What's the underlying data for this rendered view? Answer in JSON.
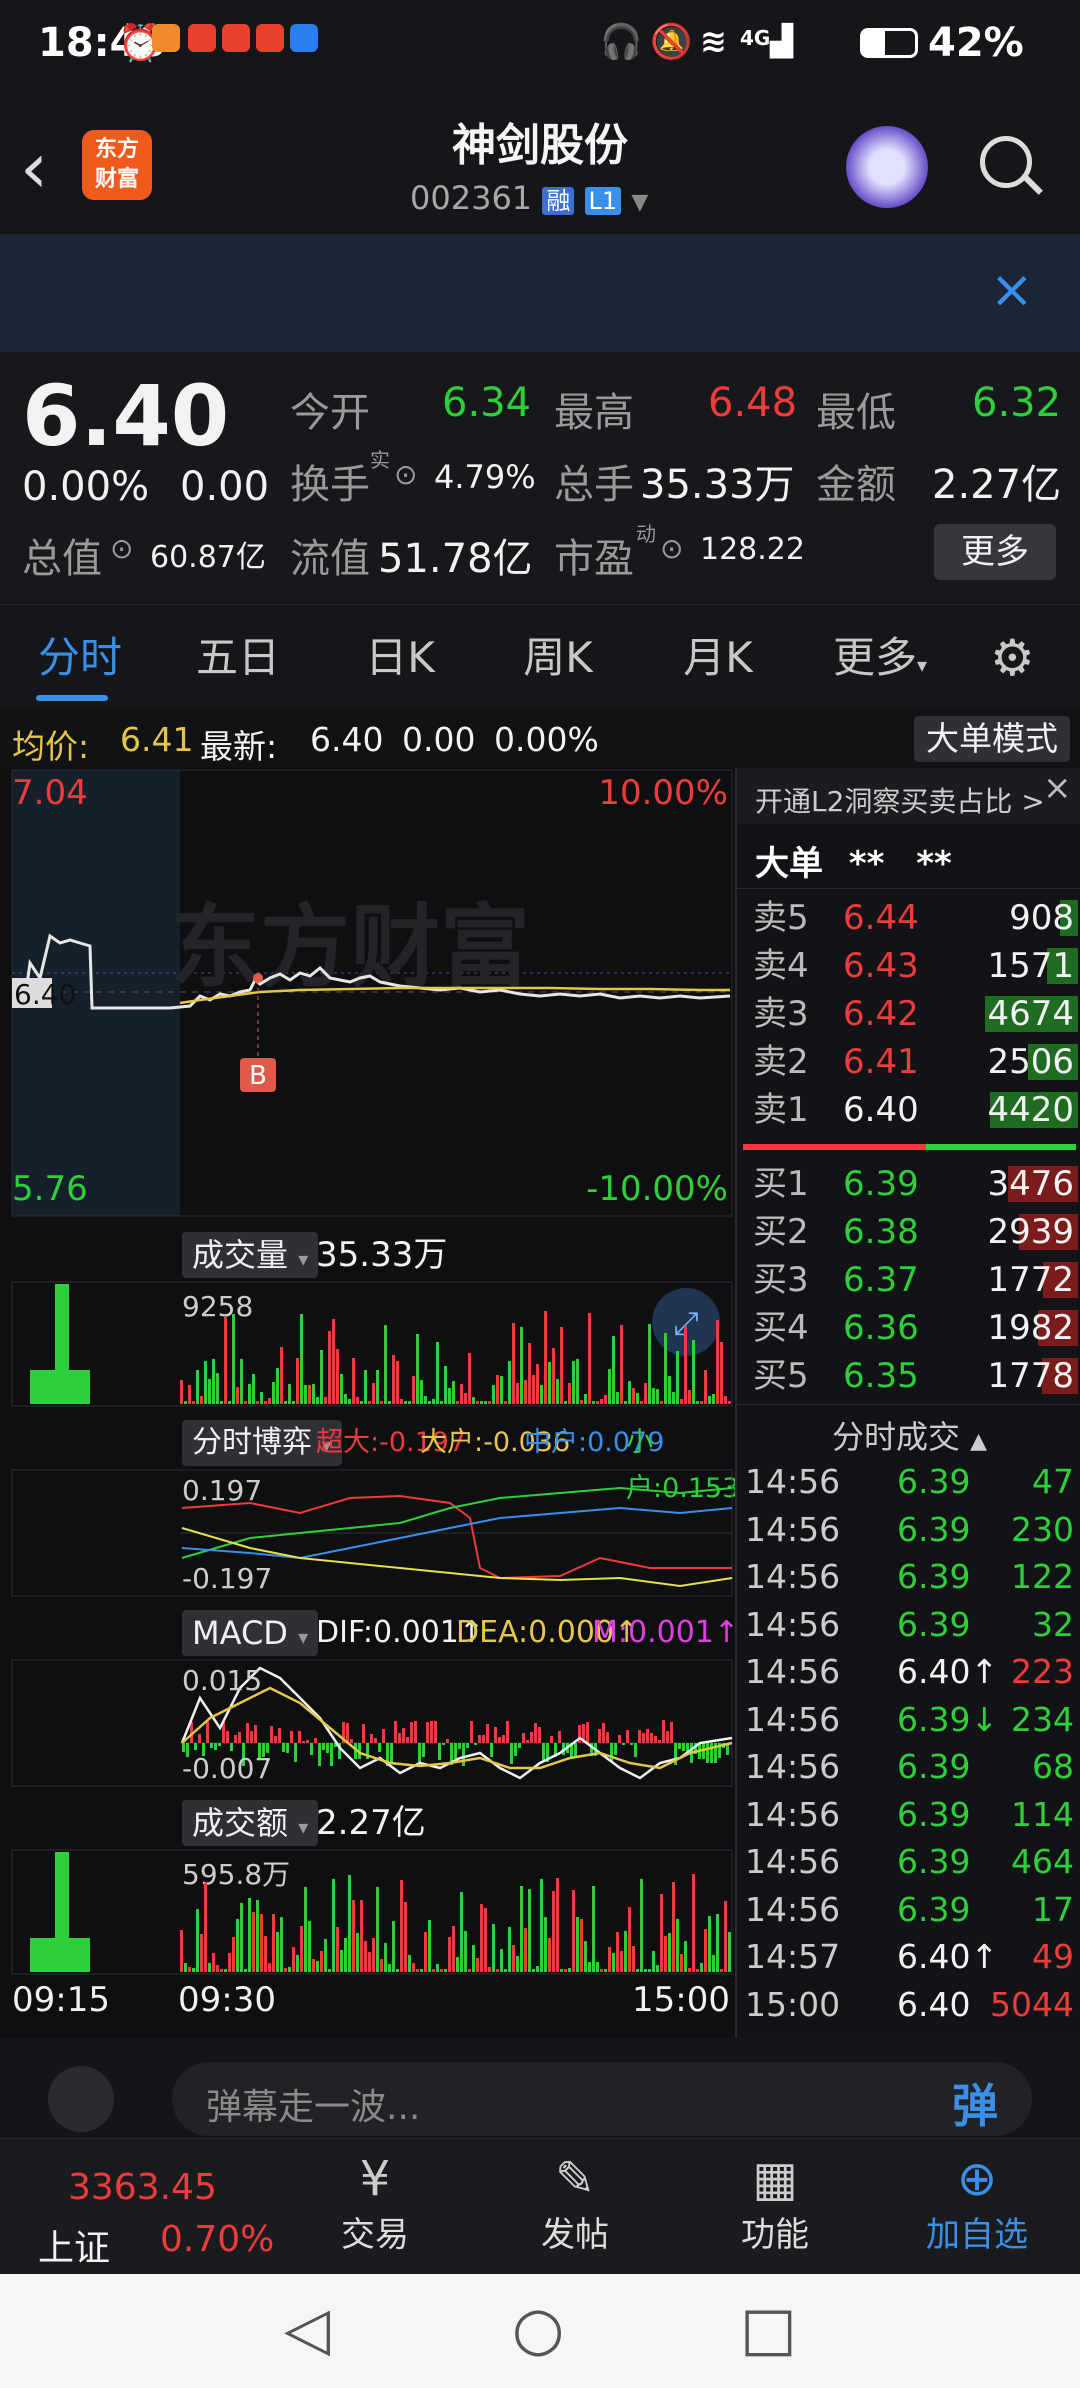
{
  "status": {
    "time": "18:48",
    "battery": "42%",
    "signal_label": "4G"
  },
  "header": {
    "app_logo": "东方\n财富",
    "stock_name": "神剑股份",
    "stock_code": "002361",
    "badge_rong": "融",
    "badge_level": "L1"
  },
  "quote": {
    "price": "6.40",
    "change_pct": "0.00%",
    "change": "0.00",
    "open_label": "今开",
    "open": "6.34",
    "high_label": "最高",
    "high": "6.48",
    "low_label": "最低",
    "low": "6.32",
    "turnover_label": "换手",
    "turnover_sup": "实",
    "turnover": "4.79%",
    "volume_label": "总手",
    "volume": "35.33万",
    "amount_label": "金额",
    "amount": "2.27亿",
    "mktcap_label": "总值",
    "mktcap": "60.87亿",
    "float_label": "流值",
    "float_value": "51.78亿",
    "pe_label": "市盈",
    "pe_sup": "动",
    "pe": "128.22",
    "more_button": "更多"
  },
  "tabs": [
    "分时",
    "五日",
    "日K",
    "周K",
    "月K",
    "更多"
  ],
  "avgbar": {
    "avg_label": "均价:",
    "avg": "6.41",
    "latest_label": "最新:",
    "latest": "6.40",
    "chg": "0.00",
    "pct": "0.00%",
    "mode_button": "大单模式"
  },
  "chart": {
    "price_top": "7.04",
    "price_bottom": "5.76",
    "pct_top": "10.00%",
    "pct_bottom": "-10.00%",
    "mid_label": "6.40",
    "marker": "B",
    "volume_label": "成交量",
    "volume_value": "35.33万",
    "volume_max": "9258",
    "game_label": "分时博弈",
    "game_super": "超大:-0.197",
    "game_big": "大户:-0.036",
    "game_mid": "中户:0.079",
    "game_small": "小户:0.153",
    "game_top": "0.197",
    "game_bottom": "-0.197",
    "macd_label": "MACD",
    "macd_dif": "DIF:0.001↑",
    "macd_dea": "DEA:0.000↑",
    "macd_m": "M:0.001↑",
    "macd_top": "0.015",
    "macd_bottom": "-0.007",
    "amount_label": "成交额",
    "amount_value": "2.27亿",
    "amount_max": "595.8万",
    "time_start": "09:15",
    "time_open": "09:30",
    "time_end": "15:00"
  },
  "orderbook": {
    "promo": "开通L2洞察买卖占比 >",
    "big_order_label": "大单",
    "big_order_a": "**",
    "big_order_b": "**",
    "asks": [
      {
        "label": "卖5",
        "price": "6.44",
        "vol": "908"
      },
      {
        "label": "卖4",
        "price": "6.43",
        "vol": "1571"
      },
      {
        "label": "卖3",
        "price": "6.42",
        "vol": "4674"
      },
      {
        "label": "卖2",
        "price": "6.41",
        "vol": "2506"
      },
      {
        "label": "卖1",
        "price": "6.40",
        "vol": "4420"
      }
    ],
    "bids": [
      {
        "label": "买1",
        "price": "6.39",
        "vol": "3476"
      },
      {
        "label": "买2",
        "price": "6.38",
        "vol": "2939"
      },
      {
        "label": "买3",
        "price": "6.37",
        "vol": "1772"
      },
      {
        "label": "买4",
        "price": "6.36",
        "vol": "1982"
      },
      {
        "label": "买5",
        "price": "6.35",
        "vol": "1778"
      }
    ],
    "ticks_title": "分时成交",
    "ticks": [
      {
        "t": "14:56",
        "p": "6.39",
        "v": "47"
      },
      {
        "t": "14:56",
        "p": "6.39",
        "v": "230"
      },
      {
        "t": "14:56",
        "p": "6.39",
        "v": "122"
      },
      {
        "t": "14:56",
        "p": "6.39",
        "v": "32"
      },
      {
        "t": "14:56",
        "p": "6.40↑",
        "v": "223"
      },
      {
        "t": "14:56",
        "p": "6.39↓",
        "v": "234"
      },
      {
        "t": "14:56",
        "p": "6.39",
        "v": "68"
      },
      {
        "t": "14:56",
        "p": "6.39",
        "v": "114"
      },
      {
        "t": "14:56",
        "p": "6.39",
        "v": "464"
      },
      {
        "t": "14:56",
        "p": "6.39",
        "v": "17"
      },
      {
        "t": "14:57",
        "p": "6.40↑",
        "v": "49"
      },
      {
        "t": "15:00",
        "p": "6.40",
        "v": "5044"
      }
    ]
  },
  "danmu": {
    "placeholder": "弹幕走一波...",
    "button": "弹"
  },
  "bottomnav": {
    "index_name": "上证",
    "index_value": "3363.45",
    "index_pct": "0.70%",
    "trade": "交易",
    "post": "发帖",
    "func": "功能",
    "add": "加自选"
  },
  "colors": {
    "up": "#ee3b3b",
    "down": "#2fcf3a",
    "accent": "#3a8fe8",
    "avg": "#e6c64a"
  }
}
